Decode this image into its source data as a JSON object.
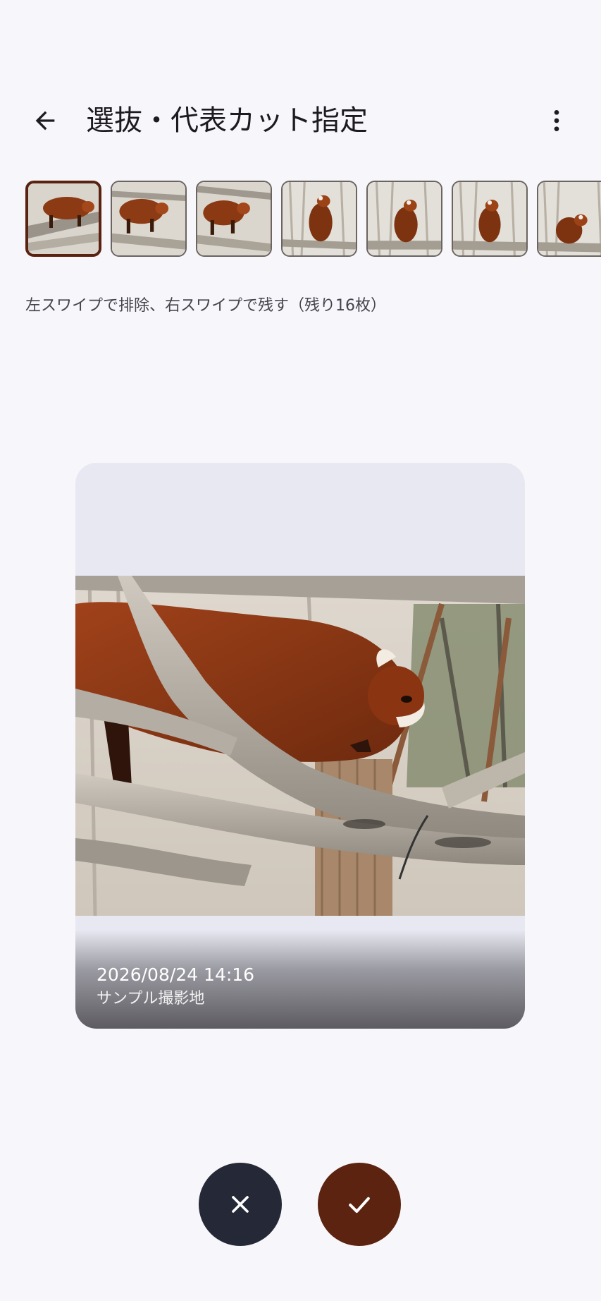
{
  "header": {
    "title": "選抜・代表カット指定",
    "back_icon": "arrow-left-icon",
    "more_icon": "more-vertical-icon"
  },
  "filmstrip": {
    "count_visible": 7,
    "selected_index": 0
  },
  "hint": "左スワイプで排除、右スワイプで残す（残り16枚）",
  "card": {
    "datetime": "2026/08/24 14:16",
    "place": "サンプル撮影地"
  },
  "actions": {
    "reject_icon": "close-icon",
    "keep_icon": "check-icon"
  },
  "colors": {
    "accent": "#5b2310",
    "dark_button": "#252836",
    "background": "#f7f6fa"
  }
}
